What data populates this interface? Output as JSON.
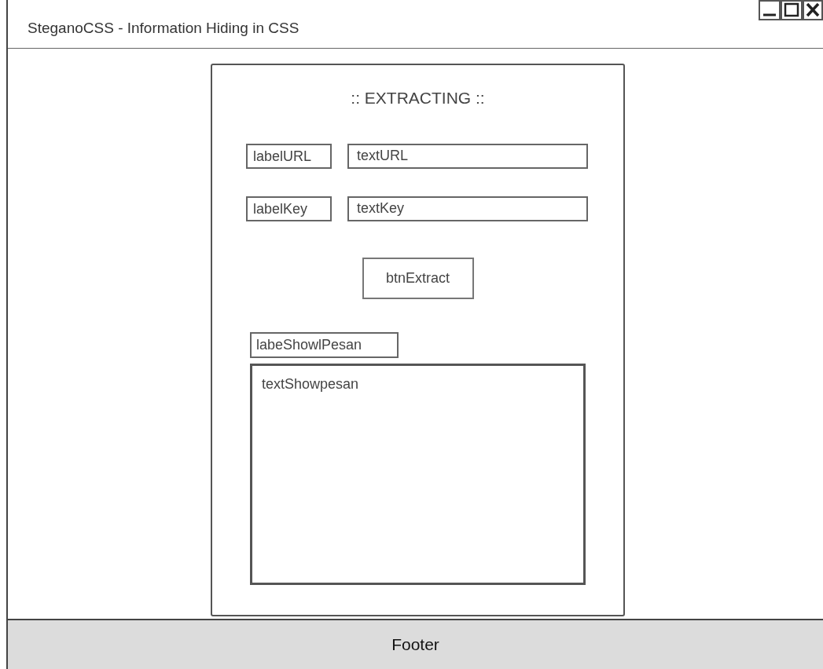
{
  "window": {
    "title": "SteganoCSS - Information Hiding in CSS"
  },
  "panel": {
    "heading": ":: EXTRACTING ::",
    "fields": [
      {
        "label": "labelURL",
        "value": "textURL"
      },
      {
        "label": "labelKey",
        "value": "textKey"
      }
    ],
    "button": "btnExtract",
    "output": {
      "label": "labeShowlPesan",
      "value": "textShowpesan"
    }
  },
  "footer": "Footer"
}
